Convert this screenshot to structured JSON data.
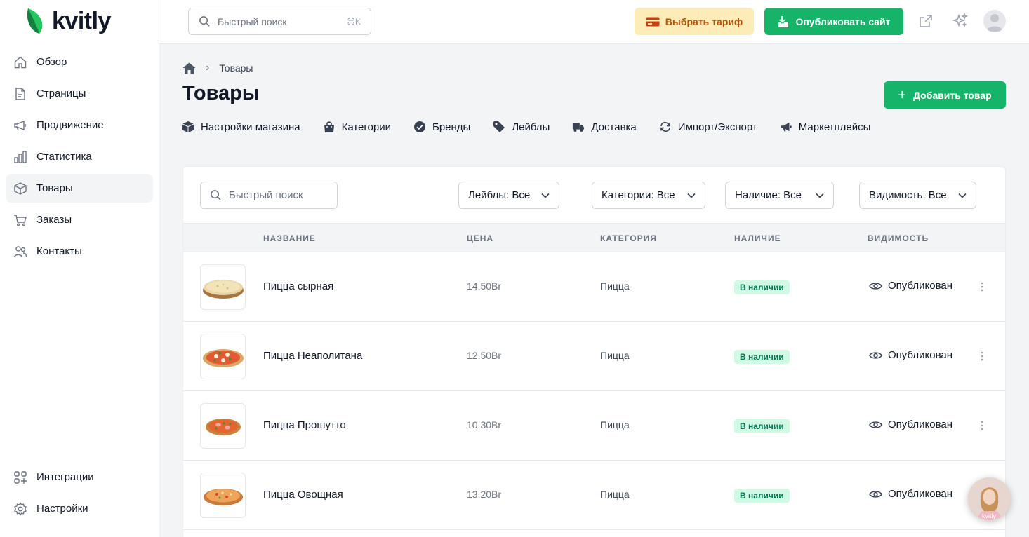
{
  "app": {
    "logo_text": "kvitly",
    "brand_color": "#16b469"
  },
  "sidebar": {
    "items": [
      {
        "label": "Обзор",
        "icon": "home-icon"
      },
      {
        "label": "Страницы",
        "icon": "file-icon"
      },
      {
        "label": "Продвижение",
        "icon": "megaphone-icon"
      },
      {
        "label": "Статистика",
        "icon": "chart-icon"
      },
      {
        "label": "Товары",
        "icon": "box-icon",
        "active": true
      },
      {
        "label": "Заказы",
        "icon": "cart-icon"
      },
      {
        "label": "Контакты",
        "icon": "users-icon"
      }
    ],
    "bottom_items": [
      {
        "label": "Интеграции",
        "icon": "grid-plus-icon"
      },
      {
        "label": "Настройки",
        "icon": "gear-icon"
      }
    ]
  },
  "topbar": {
    "search_placeholder": "Быстрый поиск",
    "search_shortcut": "⌘K",
    "tariff_label": "Выбрать тариф",
    "publish_label": "Опубликовать сайт"
  },
  "breadcrumb": {
    "current": "Товары"
  },
  "page": {
    "title": "Товары",
    "add_button": "Добавить товар"
  },
  "subnav": [
    {
      "label": "Настройки магазина",
      "icon": "cube-icon"
    },
    {
      "label": "Категории",
      "icon": "bag-icon"
    },
    {
      "label": "Бренды",
      "icon": "badge-check-icon"
    },
    {
      "label": "Лейблы",
      "icon": "tag-icon"
    },
    {
      "label": "Доставка",
      "icon": "truck-icon"
    },
    {
      "label": "Импорт/Экспорт",
      "icon": "sync-icon"
    },
    {
      "label": "Маркетплейсы",
      "icon": "bullhorn-icon"
    }
  ],
  "filters": {
    "search_placeholder": "Быстрый поиск",
    "labels": "Лейблы: Все",
    "categories": "Категории: Все",
    "availability": "Наличие: Все",
    "visibility": "Видимость: Все"
  },
  "table": {
    "headers": {
      "name": "НАЗВАНИЕ",
      "price": "ЦЕНА",
      "category": "КАТЕГОРИЯ",
      "availability": "НАЛИЧИЕ",
      "visibility": "ВИДИМОСТЬ"
    },
    "rows": [
      {
        "name": "Пицца сырная",
        "price": "14.50Br",
        "category": "Пицца",
        "availability": "В наличии",
        "visibility": "Опубликован"
      },
      {
        "name": "Пицца Неаполитана",
        "price": "12.50Br",
        "category": "Пицца",
        "availability": "В наличии",
        "visibility": "Опубликован"
      },
      {
        "name": "Пицца Прошутто",
        "price": "10.30Br",
        "category": "Пицца",
        "availability": "В наличии",
        "visibility": "Опубликован"
      },
      {
        "name": "Пицца Овощная",
        "price": "13.20Br",
        "category": "Пицца",
        "availability": "В наличии",
        "visibility": "Опубликован"
      }
    ]
  },
  "chat": {
    "watermark": "kvitly"
  }
}
